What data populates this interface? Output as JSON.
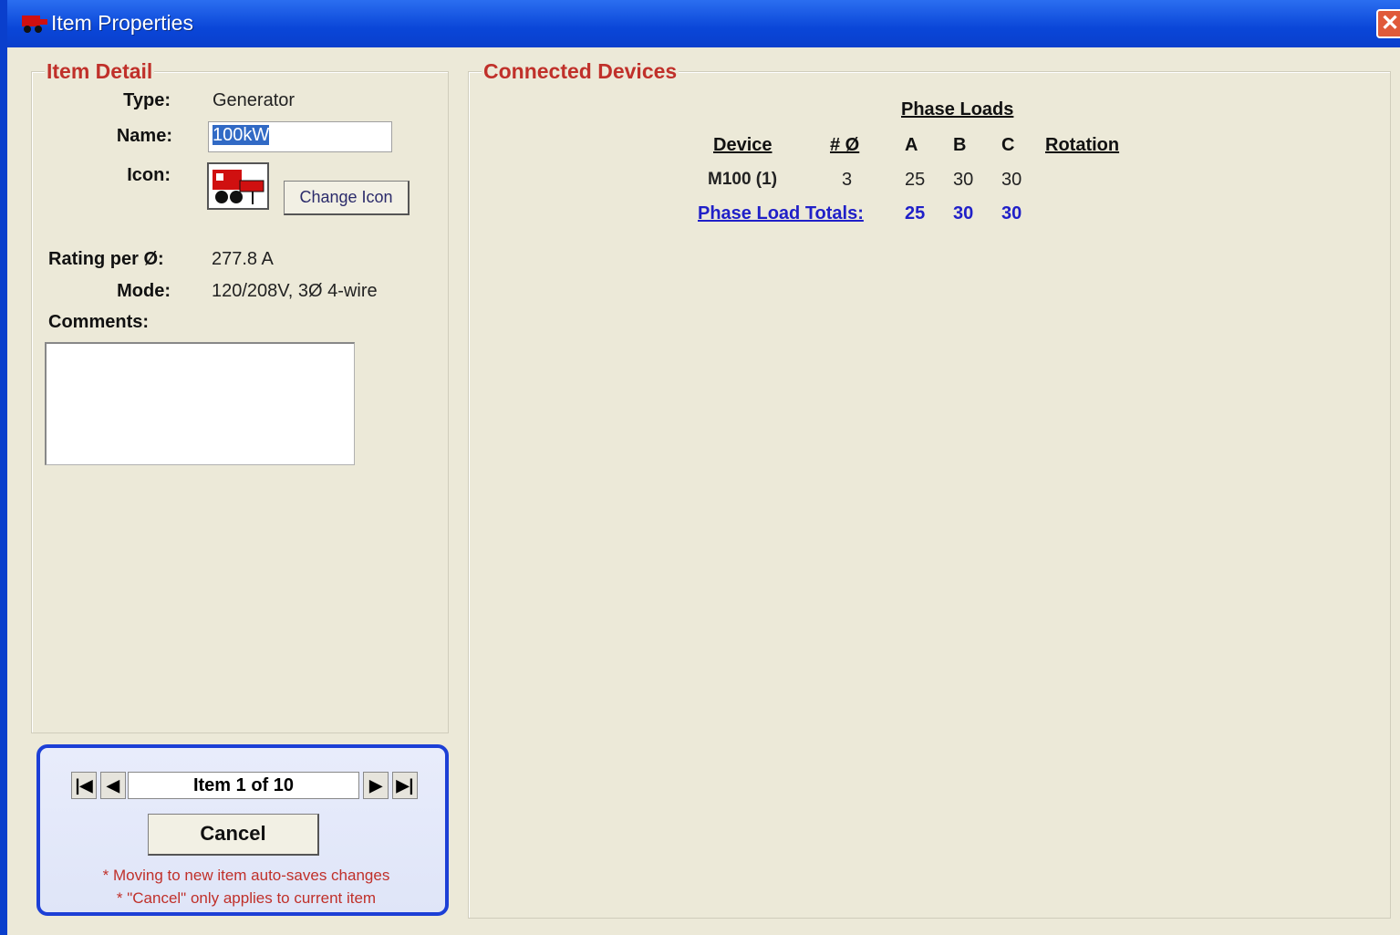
{
  "window": {
    "title": "Item Properties",
    "close_label": "✕"
  },
  "item_detail": {
    "group_title": "Item Detail",
    "type_label": "Type:",
    "type_value": "Generator",
    "name_label": "Name:",
    "name_value": "100kW",
    "icon_label": "Icon:",
    "change_icon_label": "Change Icon",
    "rating_label": "Rating per Ø:",
    "rating_value": "277.8 A",
    "mode_label": "Mode:",
    "mode_value": "120/208V, 3Ø 4-wire",
    "comments_label": "Comments:",
    "comments_value": ""
  },
  "navigator": {
    "first_label": "|◀",
    "prev_label": "◀",
    "position_text": "Item 1 of 10",
    "next_label": "▶",
    "last_label": "▶|",
    "cancel_label": "Cancel",
    "note1": "* Moving to  new item auto-saves changes",
    "note2": "* \"Cancel\" only applies to current item"
  },
  "connected": {
    "group_title": "Connected Devices",
    "phase_loads_header": "Phase Loads",
    "columns": {
      "device": "Device",
      "phases": "# Ø",
      "a": "A",
      "b": "B",
      "c": "C",
      "rotation": "Rotation"
    },
    "rows": [
      {
        "device": "M100 (1)",
        "phases": "3",
        "a": "25",
        "b": "30",
        "c": "30",
        "rotation": ""
      }
    ],
    "totals": {
      "label": "Phase Load Totals:",
      "a": "25",
      "b": "30",
      "c": "30"
    }
  },
  "colors": {
    "titlebar": "#0a46d8",
    "group_title": "#c0302a",
    "totals": "#2020c8",
    "nav_border": "#1c3fd6"
  }
}
